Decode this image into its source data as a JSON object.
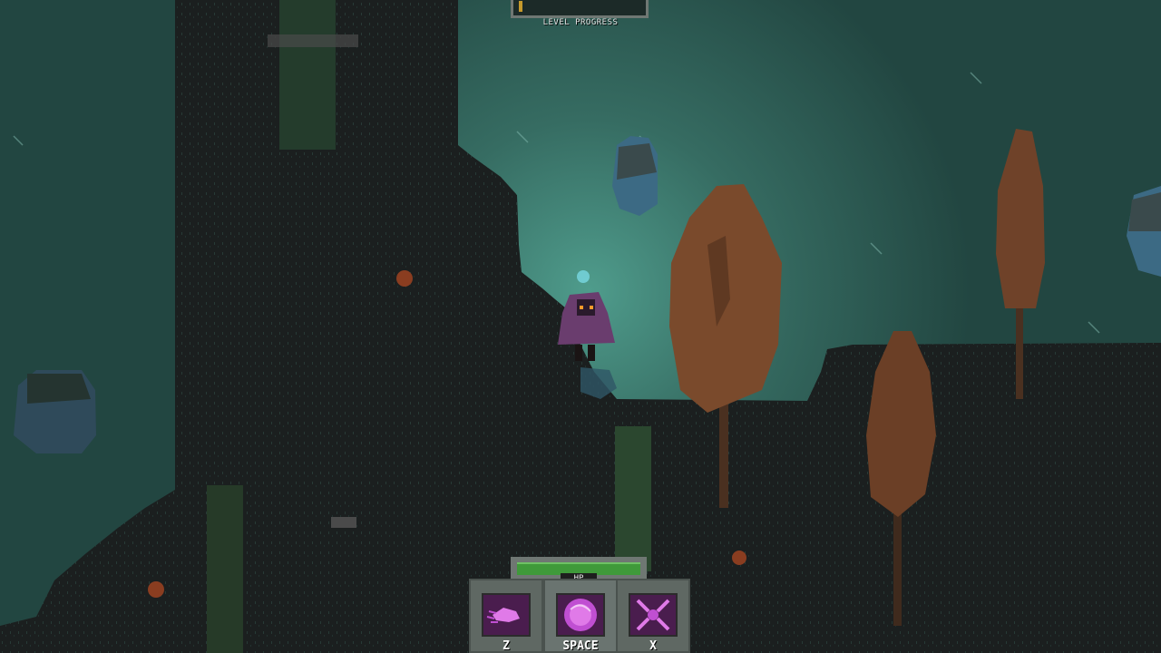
{
  "hud": {
    "level_progress_label": "LEVEL PROGRESS",
    "level_progress": 0.03,
    "hp_label": "HP",
    "hp": 1.0,
    "abilities": [
      {
        "key": "Z",
        "icon": "dash-icon"
      },
      {
        "key": "SPACE",
        "icon": "orb-icon"
      },
      {
        "key": "X",
        "icon": "burst-icon"
      }
    ]
  },
  "colors": {
    "sky": "#2e5a52",
    "ground": "#1b1f1f",
    "tree": "#7a4a2c",
    "character": "#6a3d6e",
    "accent_magic": "#c04fd2",
    "hp_green": "#3f9a3a",
    "progress_gold": "#c69a2c"
  }
}
